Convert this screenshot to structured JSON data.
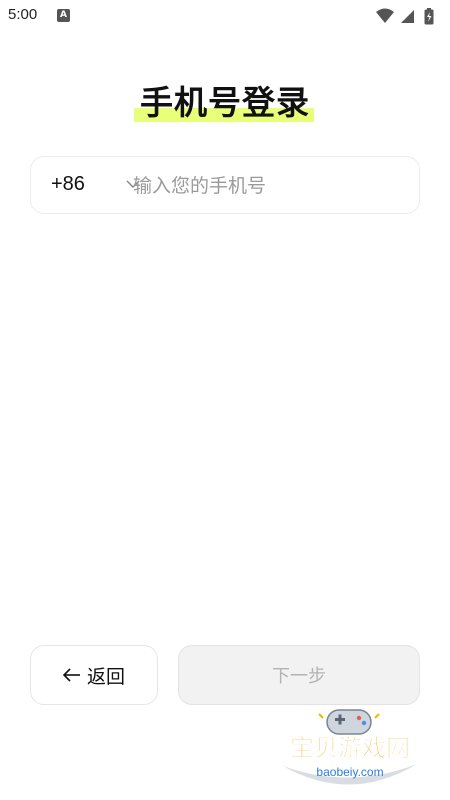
{
  "status_bar": {
    "time": "5:00",
    "notification_icon": "a-icon",
    "icons": [
      "wifi-icon",
      "signal-icon",
      "battery-icon"
    ]
  },
  "login": {
    "title": "手机号登录",
    "highlight_color": "#e8ff7a"
  },
  "phone_field": {
    "country_code": "+86",
    "value": "",
    "placeholder": "输入您的手机号"
  },
  "actions": {
    "back_label": "返回",
    "next_label": "下一步",
    "next_enabled": false
  },
  "watermark": {
    "name": "宝贝游戏网",
    "url": "baobeiy.com"
  }
}
